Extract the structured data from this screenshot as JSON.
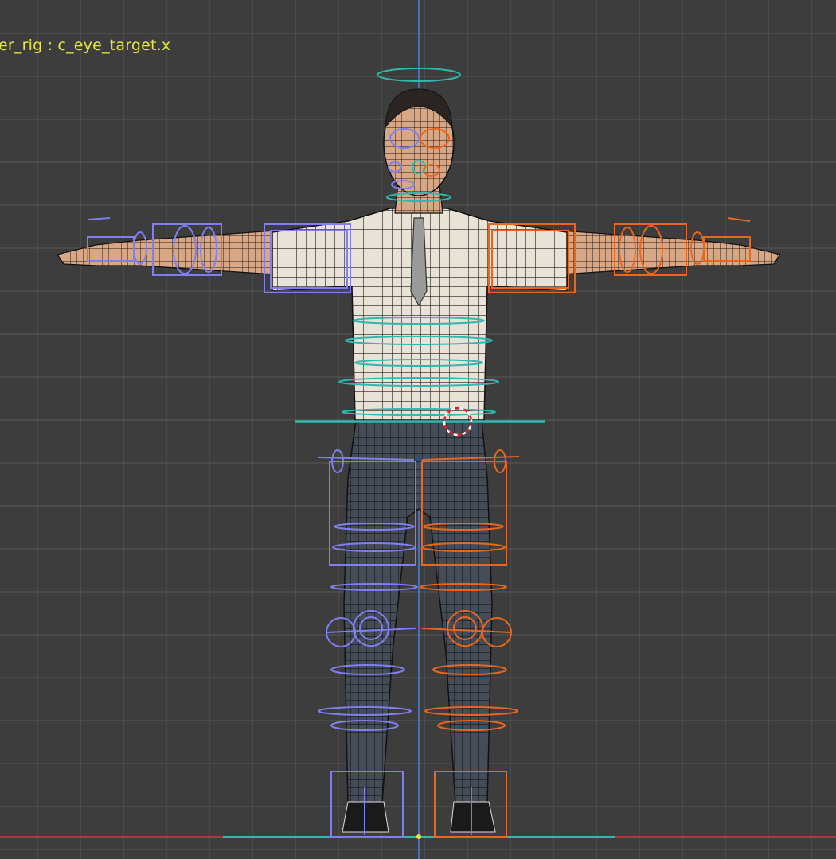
{
  "viewport": {
    "object_label": "er_rig : c_eye_target.x",
    "colors": {
      "background": "#3d3d3d",
      "grid": "#545454",
      "axis_vertical": "#4a7ad8",
      "axis_horizontal": "#b2323e",
      "label": "#e6e640",
      "controller_left": "#7f7ff0",
      "controller_right": "#e9661f",
      "controller_center": "#2fb8b0",
      "shirt": "#e9e2d6",
      "pants": "#454c57",
      "skin": "#d8a886",
      "wire": "#111111"
    }
  }
}
